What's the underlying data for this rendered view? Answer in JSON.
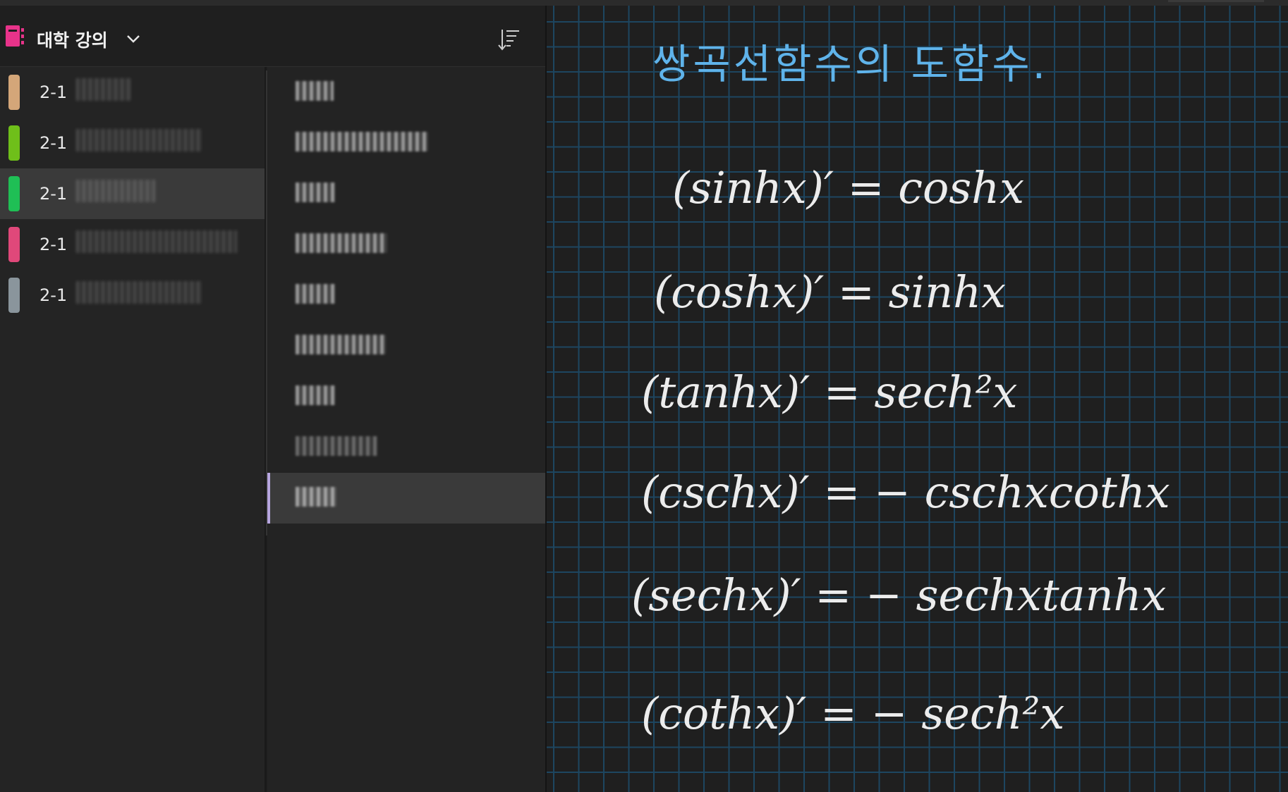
{
  "notebook": {
    "title": "대학 강의",
    "accent": "#e8338a"
  },
  "sections": [
    {
      "label": "2-1",
      "color": "#d4a679"
    },
    {
      "label": "2-1",
      "color": "#6fbf1a"
    },
    {
      "label": "2-1",
      "color": "#1fbf55",
      "selected": true
    },
    {
      "label": "2-1",
      "color": "#e0487a"
    },
    {
      "label": "2-1",
      "color": "#8a959c"
    }
  ],
  "pages_count": 9,
  "selected_page_index": 8,
  "canvas": {
    "title": "쌍곡선함수의 도함수.",
    "title_color": "#5fb3ea",
    "equations": [
      "(sinhx)′ = coshx",
      "(coshx)′ = sinhx",
      "(tanhx)′ = sech²x",
      "(cschx)′ = − cschxcothx",
      "(sechx)′ = − sechxtanhx",
      "(cothx)′ = − sech²x"
    ]
  }
}
